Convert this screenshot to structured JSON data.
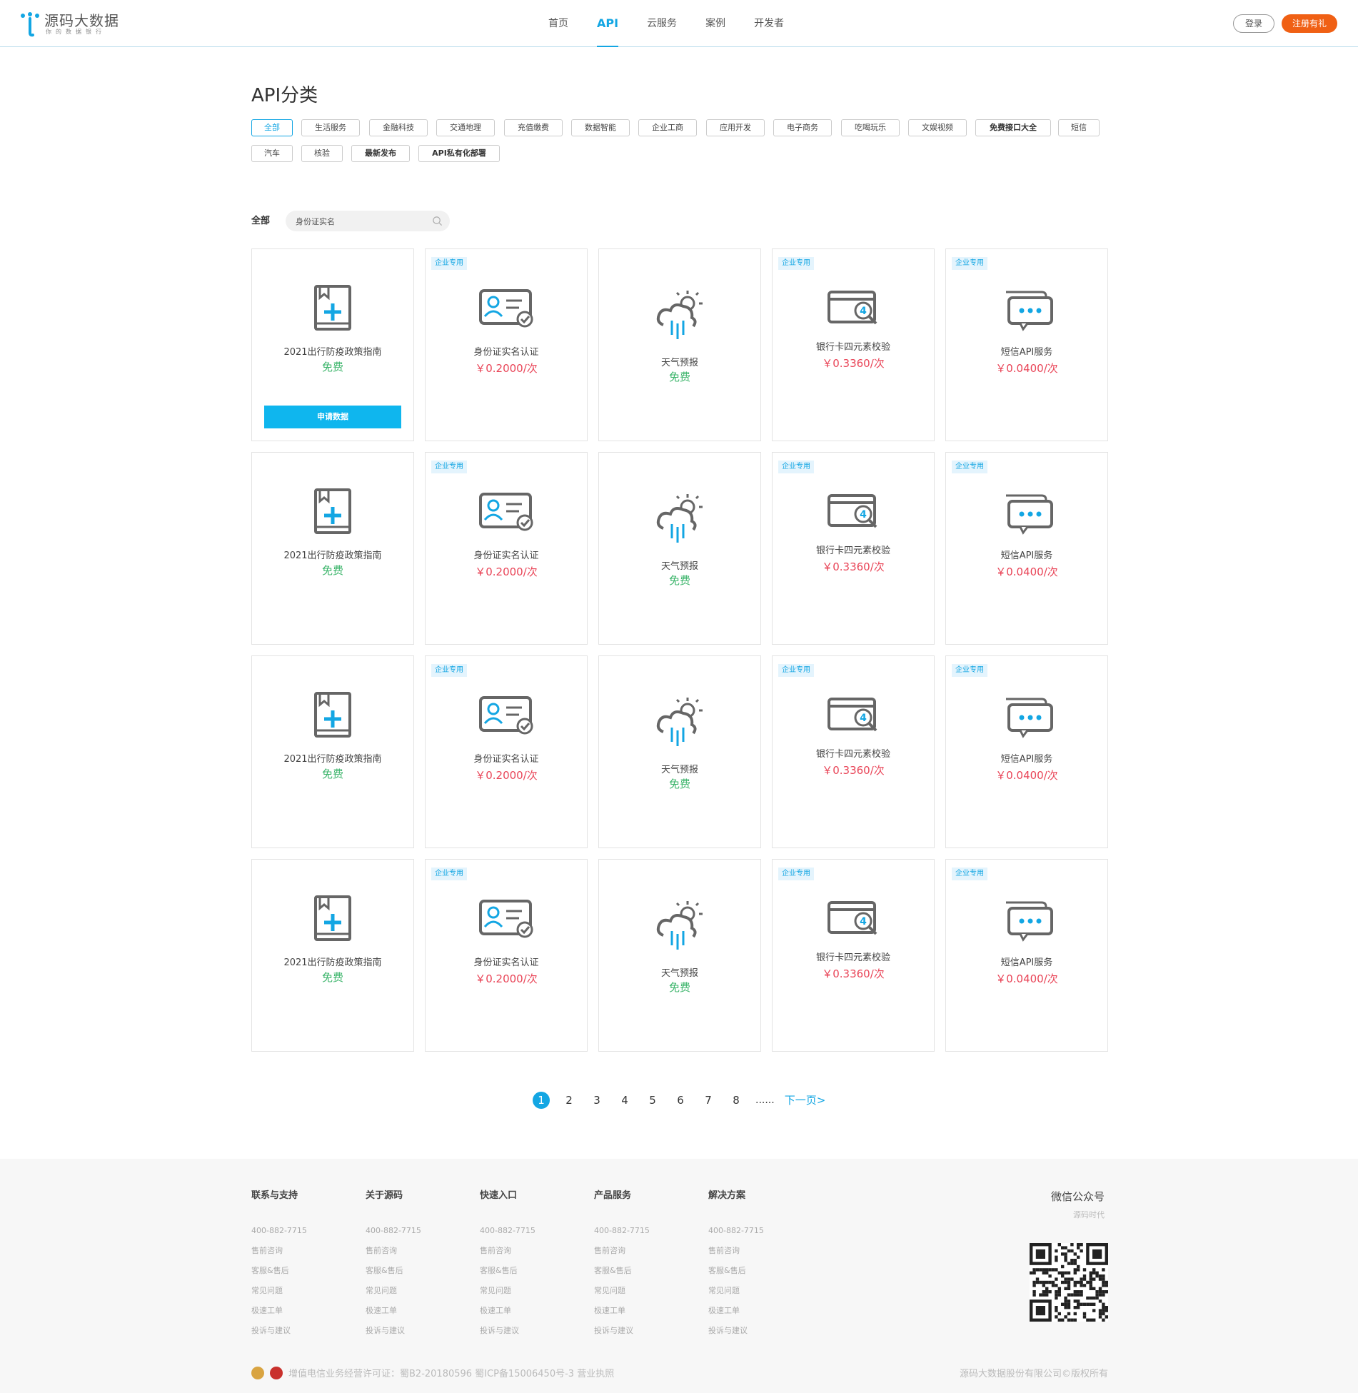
{
  "header": {
    "logo_name": "源码大数据",
    "logo_slogan": "你的数据银行",
    "nav": [
      "首页",
      "API",
      "云服务",
      "案例",
      "开发者"
    ],
    "nav_active": 1,
    "login_label": "登录",
    "register_label": "注册有礼"
  },
  "main": {
    "title": "API分类",
    "categories": [
      "全部",
      "生活服务",
      "金融科技",
      "交通地理",
      "充值缴费",
      "数据智能",
      "企业工商",
      "应用开发",
      "电子商务",
      "吃喝玩乐",
      "文娱视频",
      "免费接口大全",
      "短信",
      "汽车",
      "核验",
      "最新发布",
      "API私有化部署"
    ],
    "filter_label": "全部",
    "search_value": "身份证实名",
    "badge_text": "企业专用",
    "apply_label": "申请数据"
  },
  "products": [
    {
      "name": "2021出行防疫政策指南",
      "price": "免费",
      "icon": "book-plus-icon",
      "enterprise": false
    },
    {
      "name": "身份证实名认证",
      "price": "￥0.2000/次",
      "icon": "id-card-check-icon",
      "enterprise": true
    },
    {
      "name": "天气预报",
      "price": "免费",
      "icon": "weather-icon",
      "enterprise": false
    },
    {
      "name": "银行卡四元素校验",
      "price": "￥0.3360/次",
      "icon": "bank-card-verify-icon",
      "enterprise": true
    },
    {
      "name": "短信API服务",
      "price": "￥0.0400/次",
      "icon": "chat-message-icon",
      "enterprise": true
    }
  ],
  "pagination": {
    "pages": [
      "1",
      "2",
      "3",
      "4",
      "5",
      "6",
      "7",
      "8"
    ],
    "current": "1",
    "dots": "......",
    "next": "下一页>"
  },
  "footer": {
    "columns": [
      {
        "title": "联系与支持",
        "links": [
          "400-882-7715",
          "售前咨询",
          "客服&售后",
          "常见问题",
          "极速工单",
          "投诉与建议"
        ]
      },
      {
        "title": "关于源码",
        "links": [
          "400-882-7715",
          "售前咨询",
          "客服&售后",
          "常见问题",
          "极速工单",
          "投诉与建议"
        ]
      },
      {
        "title": "快速入口",
        "links": [
          "400-882-7715",
          "售前咨询",
          "客服&售后",
          "常见问题",
          "极速工单",
          "投诉与建议"
        ]
      },
      {
        "title": "产品服务",
        "links": [
          "400-882-7715",
          "售前咨询",
          "客服&售后",
          "常见问题",
          "极速工单",
          "投诉与建议"
        ]
      },
      {
        "title": "解决方案",
        "links": [
          "400-882-7715",
          "售前咨询",
          "客服&售后",
          "常见问题",
          "极速工单",
          "投诉与建议"
        ]
      }
    ],
    "wechat_title": "微信公众号",
    "wechat_sub": "源码时代",
    "license": "增值电信业务经营许可证：蜀B2-20180596   蜀ICP备15006450号-3   营业执照",
    "copyright": "源码大数据股份有限公司©版权所有"
  },
  "colors": {
    "accent": "#13a6e3",
    "register": "#f06014",
    "free": "#3cb56b",
    "paid": "#e94457"
  }
}
